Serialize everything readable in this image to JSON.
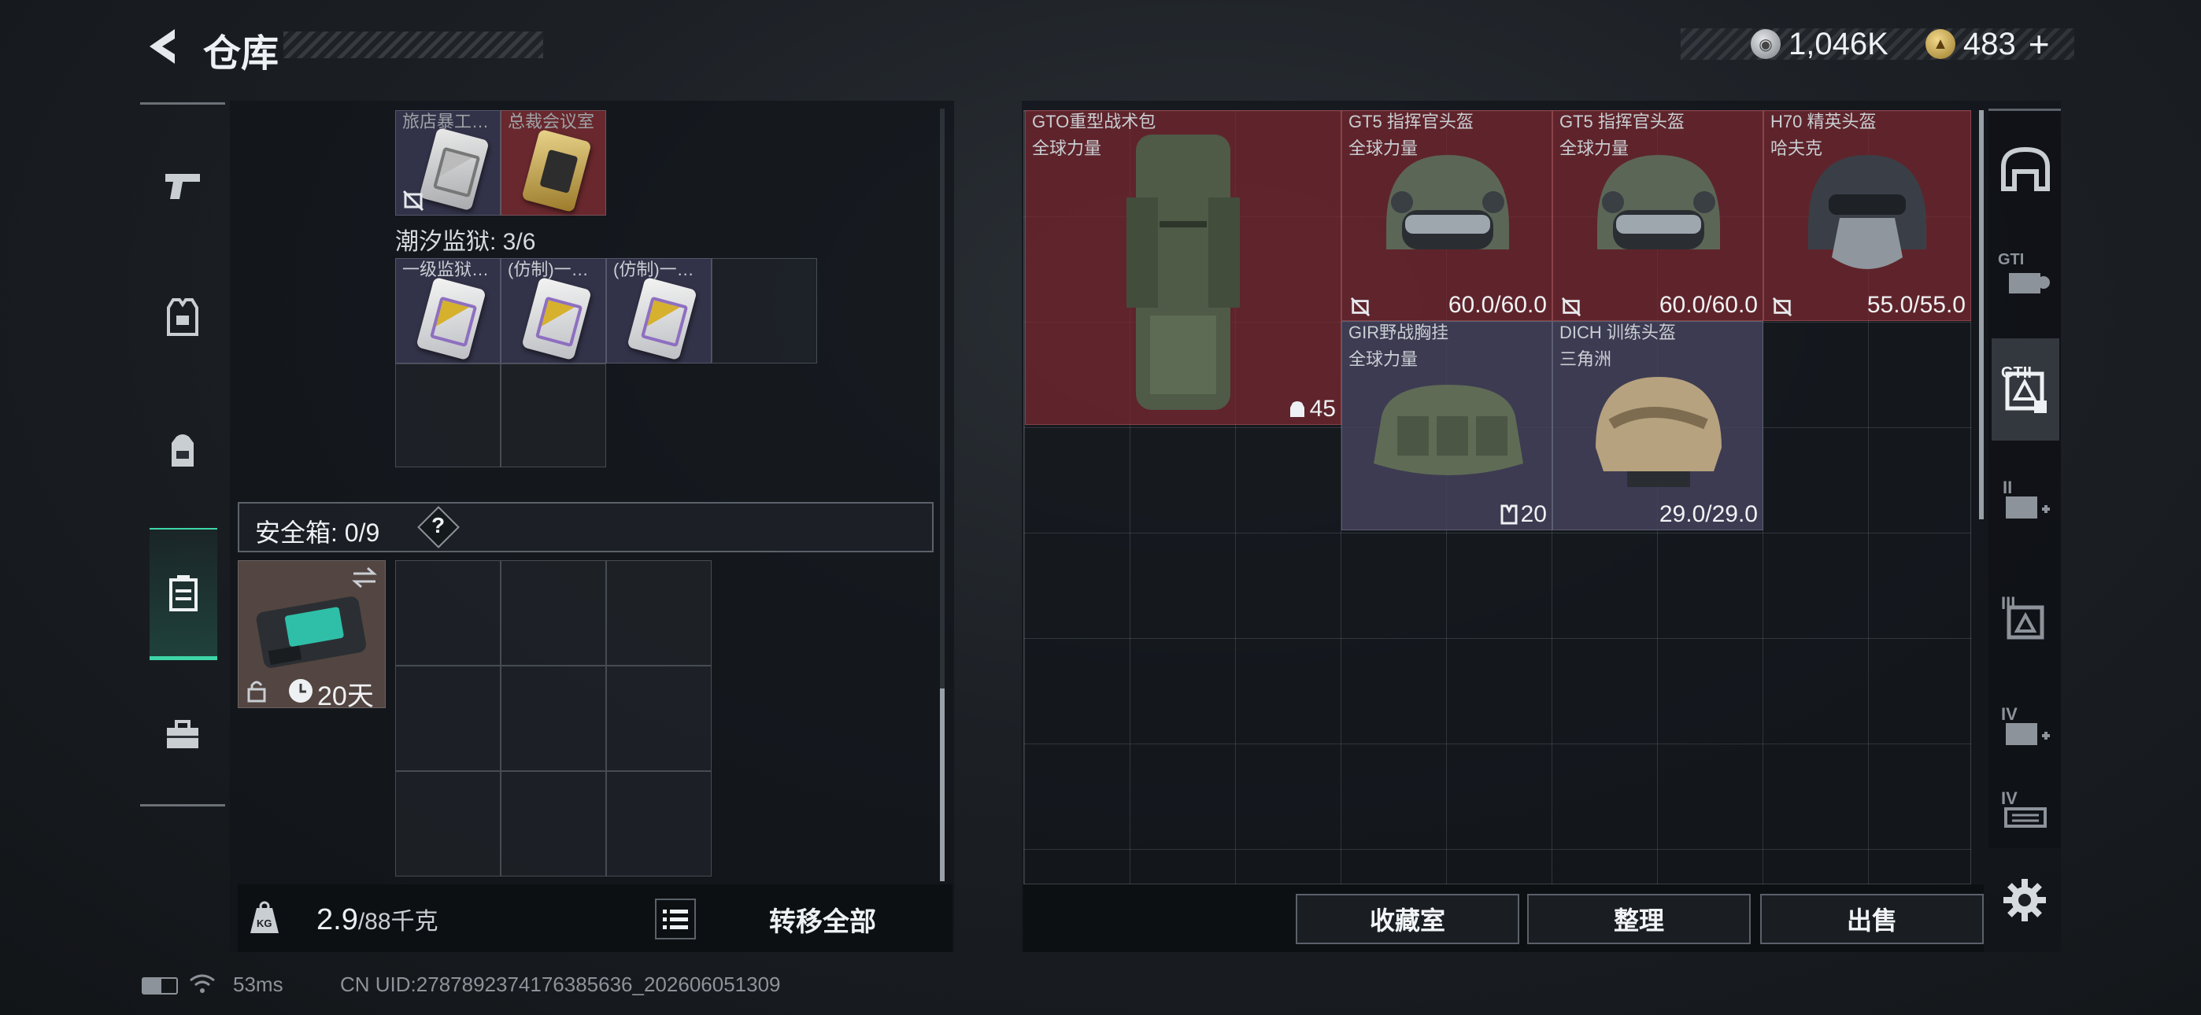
{
  "header": {
    "title": "仓库",
    "currency": [
      {
        "icon": "silver-coin-icon",
        "value": "1,046K"
      },
      {
        "icon": "gold-coin-icon",
        "value": "483"
      }
    ],
    "add_symbol": "+"
  },
  "left_nav": {
    "items": [
      {
        "name": "pistol-icon",
        "active": false
      },
      {
        "name": "vest-icon",
        "active": false
      },
      {
        "name": "backpack-icon",
        "active": false
      },
      {
        "name": "safe-box-icon",
        "active": true
      },
      {
        "name": "toolbox-icon",
        "active": false
      }
    ]
  },
  "key_slots": {
    "row1": [
      {
        "label": "旅店暴工…",
        "rarity": "purple",
        "icon": "no-trade-icon"
      },
      {
        "label": "总裁会议室",
        "rarity": "gold"
      }
    ],
    "prison": {
      "label": "潮汐监狱: 3/6",
      "items": [
        {
          "label": "一级监狱…",
          "rarity": "purple"
        },
        {
          "label": "(仿制)一…",
          "rarity": "purple"
        },
        {
          "label": "(仿制)一…",
          "rarity": "purple"
        }
      ]
    }
  },
  "safe_box": {
    "label": "安全箱: 0/9",
    "help": "?",
    "duration": "20天",
    "icons": [
      "lock-icon",
      "clock-icon",
      "swap-icon"
    ]
  },
  "footer_left": {
    "weight": "2.9",
    "weight_max": "/88千克",
    "kg_icon": "KG",
    "transfer_all": "转移全部"
  },
  "stash_items": [
    {
      "name": "GTO重型战术包",
      "sub": "全球力量",
      "value": "45",
      "value_icon": "storage-icon",
      "rarity": "red"
    },
    {
      "name": "GT5 指挥官头盔",
      "sub": "全球力量",
      "value": "60.0/60.0",
      "rarity": "red"
    },
    {
      "name": "GT5 指挥官头盔",
      "sub": "全球力量",
      "value": "60.0/60.0",
      "rarity": "red"
    },
    {
      "name": "H70 精英头盔",
      "sub": "哈夫克",
      "value": "55.0/55.0",
      "rarity": "red"
    },
    {
      "name": "GIR野战胸挂",
      "sub": "全球力量",
      "value": "20",
      "value_icon": "chest-rig-icon",
      "rarity": "purple"
    },
    {
      "name": "DICH 训练头盔",
      "sub": "三角洲",
      "value": "29.0/29.0",
      "rarity": "purple"
    }
  ],
  "footer_right": {
    "buttons": [
      "收藏室",
      "整理",
      "出售"
    ]
  },
  "right_tabs": [
    {
      "name": "helmet-category-icon",
      "label": ""
    },
    {
      "name": "tier-gt-storage-icon",
      "label": "GTI"
    },
    {
      "name": "tier-gt-active-icon",
      "label": "GTII"
    },
    {
      "name": "tier-ii-add-icon",
      "label": "II"
    },
    {
      "name": "tier-iii-icon",
      "label": "III"
    },
    {
      "name": "tier-iv-add-icon",
      "label": "IV"
    },
    {
      "name": "tier-iv-icon",
      "label": "IV"
    }
  ],
  "status_bar": {
    "ping": "53ms",
    "uid": "CN UID:2787892374176385636_202606051309"
  },
  "colors": {
    "accent": "#3fd6a7",
    "red_rarity": "#782830",
    "purple_rarity": "#373750",
    "gold_coin": "#c9a645"
  }
}
